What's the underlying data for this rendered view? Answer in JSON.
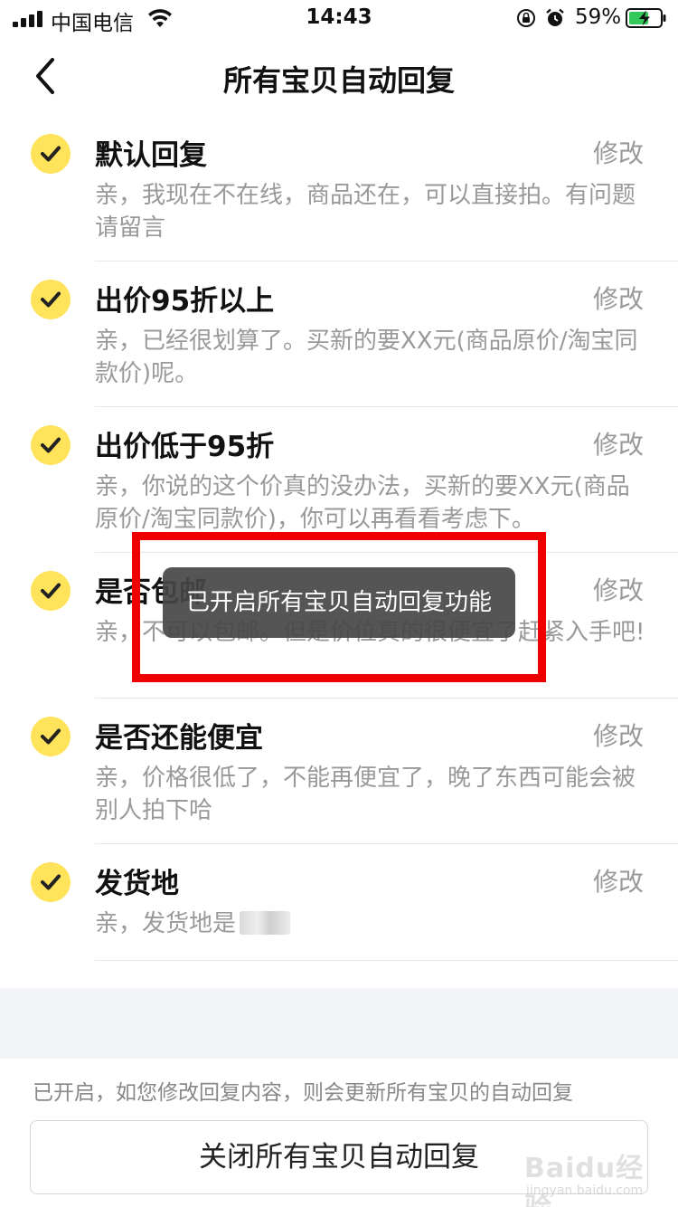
{
  "status_bar": {
    "carrier": "中国电信",
    "time": "14:43",
    "battery": "59%"
  },
  "nav": {
    "title": "所有宝贝自动回复"
  },
  "items": [
    {
      "title": "默认回复",
      "edit": "修改",
      "desc": "亲，我现在不在线，商品还在，可以直接拍。有问题请留言"
    },
    {
      "title": "出价95折以上",
      "edit": "修改",
      "desc": "亲，已经很划算了。买新的要XX元(商品原价/淘宝同款价)呢。"
    },
    {
      "title": "出价低于95折",
      "edit": "修改",
      "desc": "亲，你说的这个价真的没办法，买新的要XX元(商品原价/淘宝同款价)，你可以再看看考虑下。"
    },
    {
      "title": "是否包邮",
      "edit": "修改",
      "desc": "亲，不可以包邮。但是价位真的很便宜了赶紧入手吧!"
    },
    {
      "title": "是否还能便宜",
      "edit": "修改",
      "desc": "亲，价格很低了，不能再便宜了，晚了东西可能会被别人拍下哈"
    },
    {
      "title": "发货地",
      "edit": "修改",
      "desc": "亲，发货地是"
    }
  ],
  "footer": {
    "note": "已开启，如您修改回复内容，则会更新所有宝贝的自动回复",
    "close_button": "关闭所有宝贝自动回复"
  },
  "toast": {
    "message": "已开启所有宝贝自动回复功能"
  },
  "watermark": {
    "logo": "Baidu经验",
    "url": "jingyan.baidu.com"
  },
  "colors": {
    "accent_yellow": "#ffe35b",
    "highlight_red": "#ee0000",
    "muted_text": "#999999"
  }
}
